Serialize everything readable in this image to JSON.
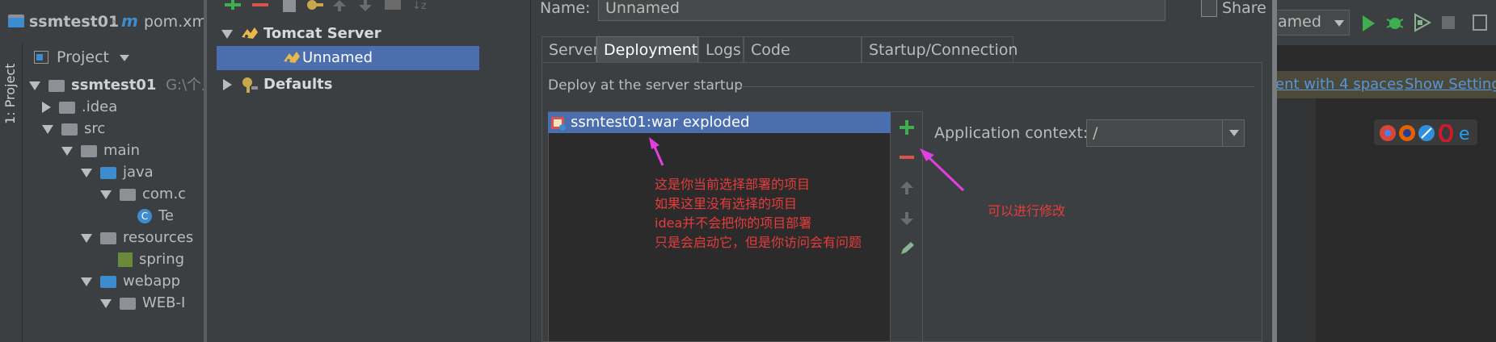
{
  "ide": {
    "project_name": "ssmtest01",
    "file_name": "pom.xml",
    "tool_window_label": "1: Project",
    "project_dropdown": "Project",
    "project_root": "ssmtest01",
    "project_path": "G:\\个人",
    "tree": [
      {
        "label": ".idea",
        "depth": 1,
        "expanded": false
      },
      {
        "label": "src",
        "depth": 1,
        "expanded": true
      },
      {
        "label": "main",
        "depth": 2,
        "expanded": true
      },
      {
        "label": "java",
        "depth": 3,
        "expanded": true
      },
      {
        "label": "com.c",
        "depth": 4,
        "expanded": true
      },
      {
        "label": "Te",
        "depth": 5,
        "expanded": null
      },
      {
        "label": "resources",
        "depth": 3,
        "expanded": true
      },
      {
        "label": "spring",
        "depth": 4,
        "expanded": null
      },
      {
        "label": "webapp",
        "depth": 3,
        "expanded": true
      },
      {
        "label": "WEB-I",
        "depth": 4,
        "expanded": true
      }
    ],
    "run_config": "amed",
    "notification_link1": "ent with 4 spaces",
    "notification_link2": "Show Settings"
  },
  "dialog": {
    "tree": {
      "tomcat_server": "Tomcat Server",
      "unnamed": "Unnamed",
      "defaults": "Defaults"
    },
    "name_label": "Name:",
    "name_value": "Unnamed",
    "share_label": "Share",
    "tabs": [
      "Server",
      "Deployment",
      "Logs",
      "Code Coverage",
      "Startup/Connection"
    ],
    "active_tab": "Deployment",
    "deploy_title": "Deploy at the server startup",
    "artifact": "ssmtest01:war exploded",
    "app_context_label": "Application context:",
    "app_context_value": "/"
  },
  "annotations": {
    "left_lines": [
      "这是你当前选择部署的项目",
      "如果这里没有选择的项目",
      "idea并不会把你的项目部署",
      "只是会启动它，但是你访问会有问题"
    ],
    "right_note": "可以进行修改"
  },
  "colors": {
    "selection": "#4b6eaf",
    "annotation": "#e83b3b",
    "arrow": "#e040e0",
    "add_green": "#3fae4f",
    "remove_red": "#d9534f",
    "link_blue": "#5895d6"
  }
}
